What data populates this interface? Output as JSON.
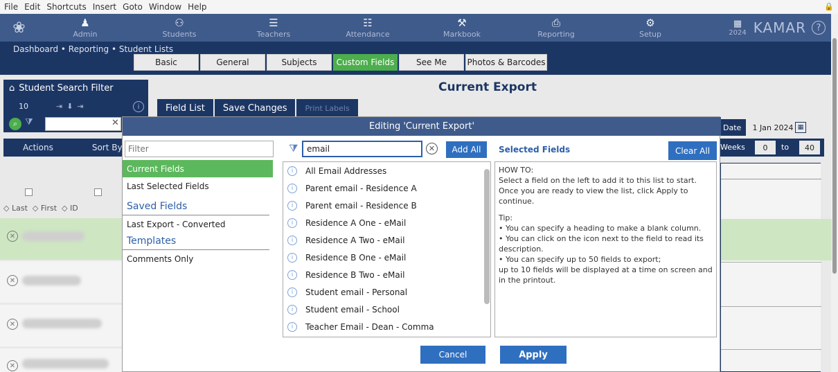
{
  "menubar": {
    "items": [
      "File",
      "Edit",
      "Shortcuts",
      "Insert",
      "Goto",
      "Window",
      "Help"
    ],
    "lock_icon": "lock-icon"
  },
  "topnav": {
    "logo_icon": "kiwi-logo-icon",
    "items": [
      {
        "label": "Admin",
        "icon": "admin-icon",
        "glyph": "♟"
      },
      {
        "label": "Students",
        "icon": "students-icon",
        "glyph": "⚇"
      },
      {
        "label": "Teachers",
        "icon": "teachers-icon",
        "glyph": "☰"
      },
      {
        "label": "Attendance",
        "icon": "attendance-icon",
        "glyph": "☷"
      },
      {
        "label": "Markbook",
        "icon": "markbook-icon",
        "glyph": "⚒"
      },
      {
        "label": "Reporting",
        "icon": "reporting-icon",
        "glyph": "⎙"
      },
      {
        "label": "Setup",
        "icon": "gear-icon",
        "glyph": "⚙"
      }
    ],
    "year": "2024",
    "brand": "KAMAR",
    "help_glyph": "?"
  },
  "subnav": {
    "breadcrumb": "Dashboard • Reporting • Student Lists",
    "tabs": [
      "Basic",
      "General",
      "Subjects",
      "Custom Fields",
      "See Me",
      "Photos & Barcodes"
    ],
    "active_tab": "Custom Fields"
  },
  "left": {
    "title": "Student Search Filter",
    "count": "10",
    "actions": "Actions",
    "sort_by": "Sort By",
    "sort_cols": [
      "Last",
      "First",
      "ID"
    ]
  },
  "main": {
    "title": "Current Export",
    "tabs": [
      "Field List",
      "Save Changes",
      "Print Labels"
    ],
    "date_label": "Date",
    "date_value": "1 Jan 2024",
    "weeks_label": "Weeks",
    "weeks_from": "0",
    "weeks_to_label": "to",
    "weeks_to": "40"
  },
  "modal": {
    "title": "Editing 'Current Export'",
    "filter_placeholder": "Filter",
    "left_items": [
      {
        "label": "Current Fields",
        "kind": "active"
      },
      {
        "label": "Last Selected Fields",
        "kind": "item"
      },
      {
        "label": "Saved Fields",
        "kind": "header"
      },
      {
        "label": "Last Export - Converted",
        "kind": "item"
      },
      {
        "label": "Templates",
        "kind": "header"
      },
      {
        "label": "Comments Only",
        "kind": "item"
      }
    ],
    "search_value": "email",
    "add_all": "Add All",
    "results": [
      "All Email Addresses",
      "Parent email - Residence A",
      "Parent email - Residence B",
      "Residence A One - eMail",
      "Residence A Two - eMail",
      "Residence B One - eMail",
      "Residence B Two - eMail",
      "Student email - Personal",
      "Student email - School",
      "Teacher Email - Dean - Comma"
    ],
    "selected_title": "Selected Fields",
    "clear_all": "Clear All",
    "howto": {
      "heading": "HOW TO:",
      "line1": " Select a field on the left to add it to this list to start.",
      "line2": " Once you are ready to view the list, click Apply to continue.",
      "tip_heading": "Tip:",
      "tip1": "• You can specify a heading to make a blank column.",
      "tip2": "• You can click on the icon next to the field to read its description.",
      "tip3": "• You can specify up to 50 fields to export;",
      "tip4": "up to 10 fields will be displayed at a time on screen and in the printout."
    },
    "cancel": "Cancel",
    "apply": "Apply"
  },
  "colors": {
    "nav": "#3f5b8c",
    "dark": "#1c3664",
    "accent_green": "#5cb85c",
    "button_blue": "#2f6fbf"
  }
}
